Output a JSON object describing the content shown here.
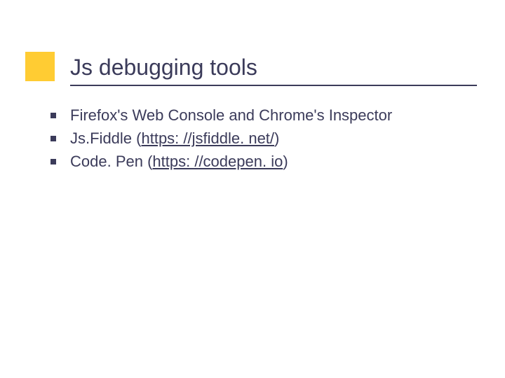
{
  "slide": {
    "title": "Js debugging tools",
    "items": [
      {
        "text_pre": "Firefox's Web Console and Chrome's Inspector",
        "link": "",
        "text_post": ""
      },
      {
        "text_pre": "Js.Fiddle (",
        "link": "https: //jsfiddle. net/",
        "text_post": ")"
      },
      {
        "text_pre": "Code. Pen (",
        "link": "https: //codepen. io",
        "text_post": ")"
      }
    ]
  }
}
